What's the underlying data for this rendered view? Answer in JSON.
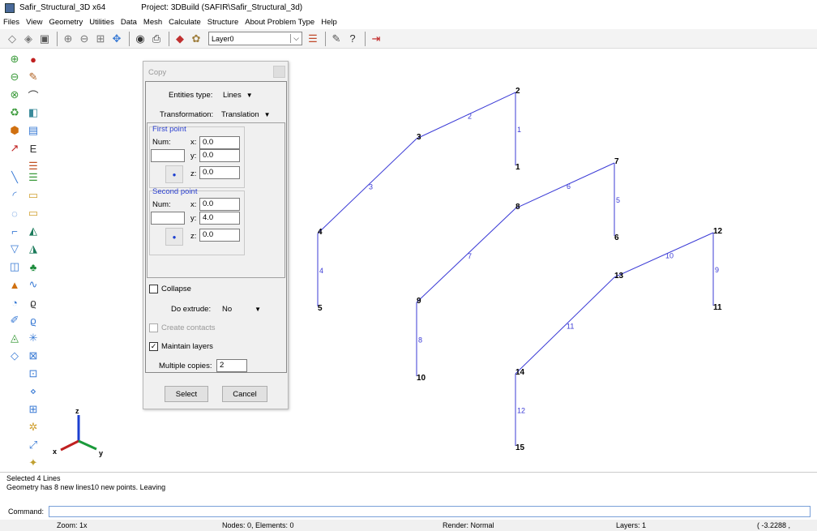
{
  "window": {
    "app_title": "Safir_Structural_3D x64",
    "project_title": "Project: 3DBuild (SAFIR\\Safir_Structural_3d)"
  },
  "menu": [
    "Files",
    "View",
    "Geometry",
    "Utilities",
    "Data",
    "Mesh",
    "Calculate",
    "Structure",
    "About Problem Type",
    "Help"
  ],
  "toolbar": {
    "layer": "Layer0"
  },
  "dialog": {
    "title": "Copy",
    "entities_label": "Entities type:",
    "entities_value": "Lines",
    "transformation_label": "Transformation:",
    "transformation_value": "Translation",
    "first_point": {
      "title": "First point",
      "num_label": "Num:",
      "num_value": "",
      "x": "0.0",
      "y": "0.0",
      "z": "0.0"
    },
    "second_point": {
      "title": "Second point",
      "num_label": "Num:",
      "num_value": "",
      "x": "0.0",
      "y": "4.0",
      "z": "0.0"
    },
    "axis_labels": {
      "x": "x:",
      "y": "y:",
      "z": "z:"
    },
    "collapse_label": "Collapse",
    "collapse_checked": false,
    "extrude_label": "Do extrude:",
    "extrude_value": "No",
    "contacts_label": "Create contacts",
    "contacts_checked": false,
    "maintain_label": "Maintain layers",
    "maintain_checked": true,
    "copies_label": "Multiple copies:",
    "copies_value": "2",
    "select_label": "Select",
    "cancel_label": "Cancel"
  },
  "viewport": {
    "colors": {
      "line": "#3b3bd6",
      "label": "#3b3bd6",
      "point": "#000000"
    },
    "points": [
      {
        "id": "2",
        "pos": "top"
      },
      {
        "id": "3",
        "pos": "top"
      },
      {
        "id": "4",
        "pos": "left"
      },
      {
        "id": "5",
        "pos": "bottom"
      },
      {
        "id": "1",
        "pos": "bottom"
      },
      {
        "id": "6",
        "pos": "bottom"
      },
      {
        "id": "7",
        "pos": "top"
      },
      {
        "id": "8",
        "pos": "top"
      },
      {
        "id": "9",
        "pos": "top"
      },
      {
        "id": "10",
        "pos": "bottom"
      },
      {
        "id": "11",
        "pos": "bottom"
      },
      {
        "id": "12",
        "pos": "top"
      },
      {
        "id": "13",
        "pos": "top"
      },
      {
        "id": "14",
        "pos": "top"
      },
      {
        "id": "15",
        "pos": "bottom"
      }
    ],
    "lines": [
      {
        "id": "1",
        "from": "2",
        "to": "1"
      },
      {
        "id": "2",
        "from": "3",
        "to": "2"
      },
      {
        "id": "3",
        "from": "4",
        "to": "3"
      },
      {
        "id": "4",
        "from": "4",
        "to": "5"
      },
      {
        "id": "5",
        "from": "7",
        "to": "6"
      },
      {
        "id": "6",
        "from": "8",
        "to": "7"
      },
      {
        "id": "7",
        "from": "9",
        "to": "8"
      },
      {
        "id": "8",
        "from": "9",
        "to": "10"
      },
      {
        "id": "9",
        "from": "12",
        "to": "11"
      },
      {
        "id": "10",
        "from": "13",
        "to": "12"
      },
      {
        "id": "11",
        "from": "14",
        "to": "13"
      },
      {
        "id": "12",
        "from": "14",
        "to": "15"
      }
    ],
    "axes": {
      "x": "x",
      "y": "y",
      "z": "z"
    }
  },
  "messages": [
    "Selected 4 Lines",
    "Geometry has 8 new lines10 new points. Leaving"
  ],
  "command": {
    "label": "Command:",
    "value": ""
  },
  "status": {
    "zoom": "Zoom: 1x",
    "nodes": "Nodes: 0, Elements: 0",
    "render": "Render: Normal",
    "layers": "Layers: 1",
    "coords": "( -3.2288 ,"
  }
}
